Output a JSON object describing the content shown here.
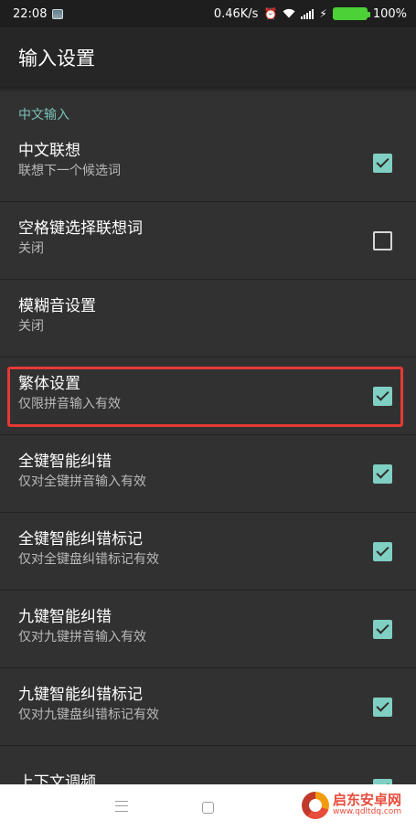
{
  "status_bar": {
    "time": "22:08",
    "network_speed": "0.46K/s",
    "battery_percent": "100%",
    "icons": [
      "image-notification-icon",
      "alarm-icon",
      "wifi-icon",
      "signal-icon",
      "charging-icon",
      "battery-icon"
    ]
  },
  "app_bar": {
    "title": "输入设置"
  },
  "category": {
    "label": "中文输入"
  },
  "preferences": [
    {
      "title": "中文联想",
      "summary": "联想下一个候选词",
      "checkbox": "checked"
    },
    {
      "title": "空格键选择联想词",
      "summary": "关闭",
      "checkbox": "unchecked"
    },
    {
      "title": "模糊音设置",
      "summary": "关闭",
      "checkbox": "none"
    },
    {
      "title": "繁体设置",
      "summary": "仅限拼音输入有效",
      "checkbox": "checked"
    },
    {
      "title": "全键智能纠错",
      "summary": "仅对全键拼音输入有效",
      "checkbox": "checked"
    },
    {
      "title": "全键智能纠错标记",
      "summary": "仅对全键盘纠错标记有效",
      "checkbox": "checked"
    },
    {
      "title": "九键智能纠错",
      "summary": "仅对九键拼音输入有效",
      "checkbox": "checked"
    },
    {
      "title": "九键智能纠错标记",
      "summary": "仅对九键盘纠错标记有效",
      "checkbox": "checked"
    },
    {
      "title": "上下文调频",
      "summary": "",
      "checkbox": "checked"
    }
  ],
  "colors": {
    "accent": "#7fcfc2",
    "category_text": "#7ac2b8",
    "highlight_frame": "#e53935",
    "background": "#313131",
    "app_bar": "#262626"
  },
  "watermark": {
    "title": "启东安卓网",
    "url": "www.qdltdq.com"
  }
}
